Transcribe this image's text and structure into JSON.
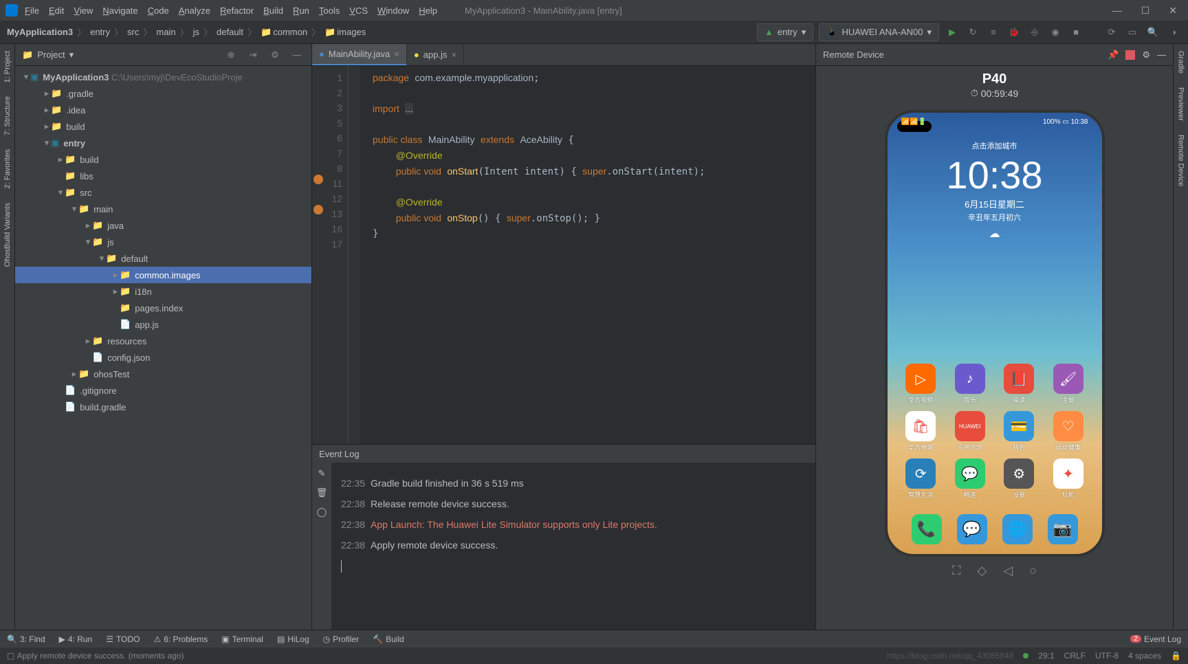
{
  "window": {
    "title": "MyApplication3 - MainAbility.java [entry]",
    "menu": [
      "File",
      "Edit",
      "View",
      "Navigate",
      "Code",
      "Analyze",
      "Refactor",
      "Build",
      "Run",
      "Tools",
      "VCS",
      "Window",
      "Help"
    ]
  },
  "breadcrumb": [
    "MyApplication3",
    "entry",
    "src",
    "main",
    "js",
    "default",
    "common",
    "images"
  ],
  "nav": {
    "config_selector": "entry",
    "device_selector": "HUAWEI ANA-AN00"
  },
  "project": {
    "title": "Project",
    "root": "MyApplication3",
    "root_path": "C:\\Users\\myj\\DevEcoStudioProje",
    "nodes": {
      "gradle": ".gradle",
      "idea": ".idea",
      "build": "build",
      "entry": "entry",
      "entry_build": "build",
      "libs": "libs",
      "src": "src",
      "main": "main",
      "java": "java",
      "js": "js",
      "default": "default",
      "common_images": "common.images",
      "i18n": "i18n",
      "pages_index": "pages.index",
      "app_js": "app.js",
      "resources": "resources",
      "config_json": "config.json",
      "ohosTest": "ohosTest",
      "gitignore": ".gitignore",
      "build_gradle": "build.gradle"
    }
  },
  "tabs": [
    {
      "label": "MainAbility.java",
      "active": true,
      "icon": "java"
    },
    {
      "label": "app.js",
      "active": false,
      "icon": "js"
    }
  ],
  "code_lines": [
    "1",
    "2",
    "3",
    "5",
    "6",
    "7",
    "8",
    "11",
    "12",
    "13",
    "16",
    "17"
  ],
  "remote": {
    "title": "Remote Device",
    "device": "P40",
    "timer": "00:59:49",
    "phone": {
      "city_prompt": "点击添加城市",
      "time": "10:38",
      "date": "6月15日星期二",
      "lunar": "辛丑年五月初六",
      "status_right": "100% ▭ 10:38",
      "apps": [
        {
          "name": "华为视频",
          "color": "#ff6a00",
          "icon": "▷"
        },
        {
          "name": "音乐",
          "color": "#6a5acd",
          "icon": "♪"
        },
        {
          "name": "阅读",
          "color": "#e74c3c",
          "icon": "📕"
        },
        {
          "name": "主题",
          "color": "#9b59b6",
          "icon": "🖌"
        },
        {
          "name": "华为商城",
          "color": "#ffffff",
          "icon": "🛍"
        },
        {
          "name": "应用市场",
          "color": "#e74c3c",
          "icon": "HUAWEI"
        },
        {
          "name": "钱包",
          "color": "#3498db",
          "icon": "💳"
        },
        {
          "name": "运动健康",
          "color": "#ff8c42",
          "icon": "♡"
        },
        {
          "name": "智慧生活",
          "color": "#2980b9",
          "icon": "⟳"
        },
        {
          "name": "畅连",
          "color": "#2ecc71",
          "icon": "💬"
        },
        {
          "name": "设置",
          "color": "#555",
          "icon": "⚙"
        },
        {
          "name": "玩机",
          "color": "#fff",
          "icon": "✦"
        }
      ],
      "dock": [
        {
          "color": "#2ecc71",
          "icon": "📞"
        },
        {
          "color": "#3498db",
          "icon": "💬"
        },
        {
          "color": "#3498db",
          "icon": "🌐"
        },
        {
          "color": "#3498db",
          "icon": "📷"
        }
      ]
    }
  },
  "event_log": {
    "title": "Event Log",
    "entries": [
      {
        "time": "22:35",
        "text": "Gradle build finished in 36 s 519 ms",
        "error": false
      },
      {
        "time": "22:38",
        "text": "Release remote device success.",
        "error": false
      },
      {
        "time": "22:38",
        "text": "App Launch: The Huawei Lite Simulator supports only Lite projects.",
        "error": true
      },
      {
        "time": "22:38",
        "text": "Apply remote device success.",
        "error": false
      }
    ]
  },
  "bottom_tools": {
    "find": "3: Find",
    "run": "4: Run",
    "todo": "TODO",
    "problems": "6: Problems",
    "terminal": "Terminal",
    "hilog": "HiLog",
    "profiler": "Profiler",
    "build_tool": "Build",
    "event_log_label": "Event Log",
    "event_badge": "2"
  },
  "status": {
    "message": "Apply remote device success. (moments ago)",
    "watermark": "https://blog.csdn.net/qq_43085848",
    "position": "29:1",
    "line_ending": "CRLF",
    "encoding": "UTF-8",
    "indent": "4 spaces"
  },
  "left_gutter": [
    "1: Project",
    "7: Structure",
    "2: Favorites",
    "OhosBuild Variants"
  ],
  "right_gutter": [
    "Gradle",
    "Previewer",
    "Remote Device"
  ]
}
